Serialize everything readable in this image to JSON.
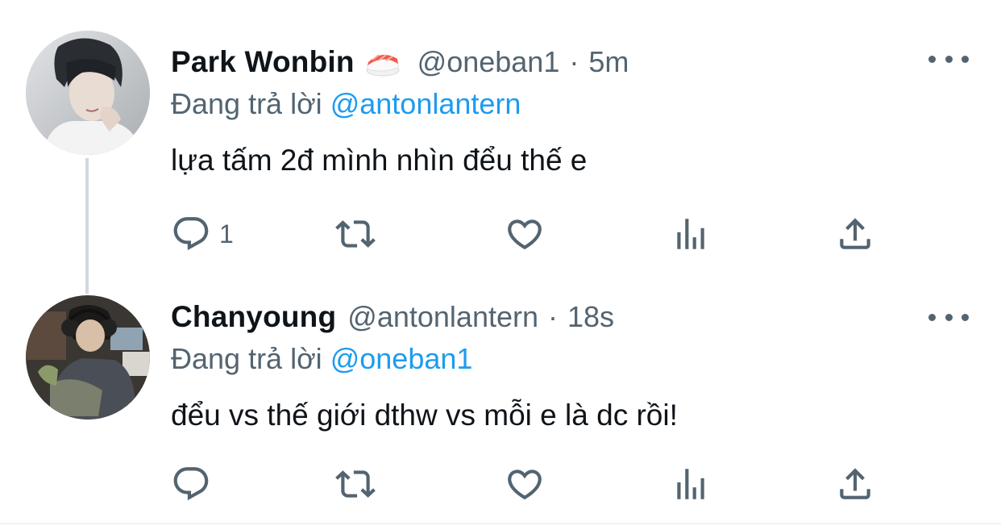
{
  "tweets": [
    {
      "display_name": "Park Wonbin",
      "name_emoji": "sushi-emoji",
      "handle": "@oneban1",
      "separator": "·",
      "time": "5m",
      "reply_prefix": "Đang trả lời",
      "reply_to": "@antonlantern",
      "text": "lựa tấm 2đ mình nhìn đểu thế e",
      "reply_count": "1",
      "icons": [
        "reply-icon",
        "retweet-icon",
        "like-icon",
        "views-icon",
        "share-icon",
        "more-icon"
      ]
    },
    {
      "display_name": "Chanyoung",
      "handle": "@antonlantern",
      "separator": "·",
      "time": "18s",
      "reply_prefix": "Đang trả lời",
      "reply_to": "@oneban1",
      "text": "đểu vs thế giới dthw vs mỗi e là dc rồi!",
      "reply_count": "",
      "icons": [
        "reply-icon",
        "retweet-icon",
        "like-icon",
        "views-icon",
        "share-icon",
        "more-icon"
      ]
    }
  ],
  "colors": {
    "text_primary": "#0f1419",
    "text_secondary": "#536471",
    "mention": "#1d9bf0",
    "thread_line": "#cfd9de"
  }
}
